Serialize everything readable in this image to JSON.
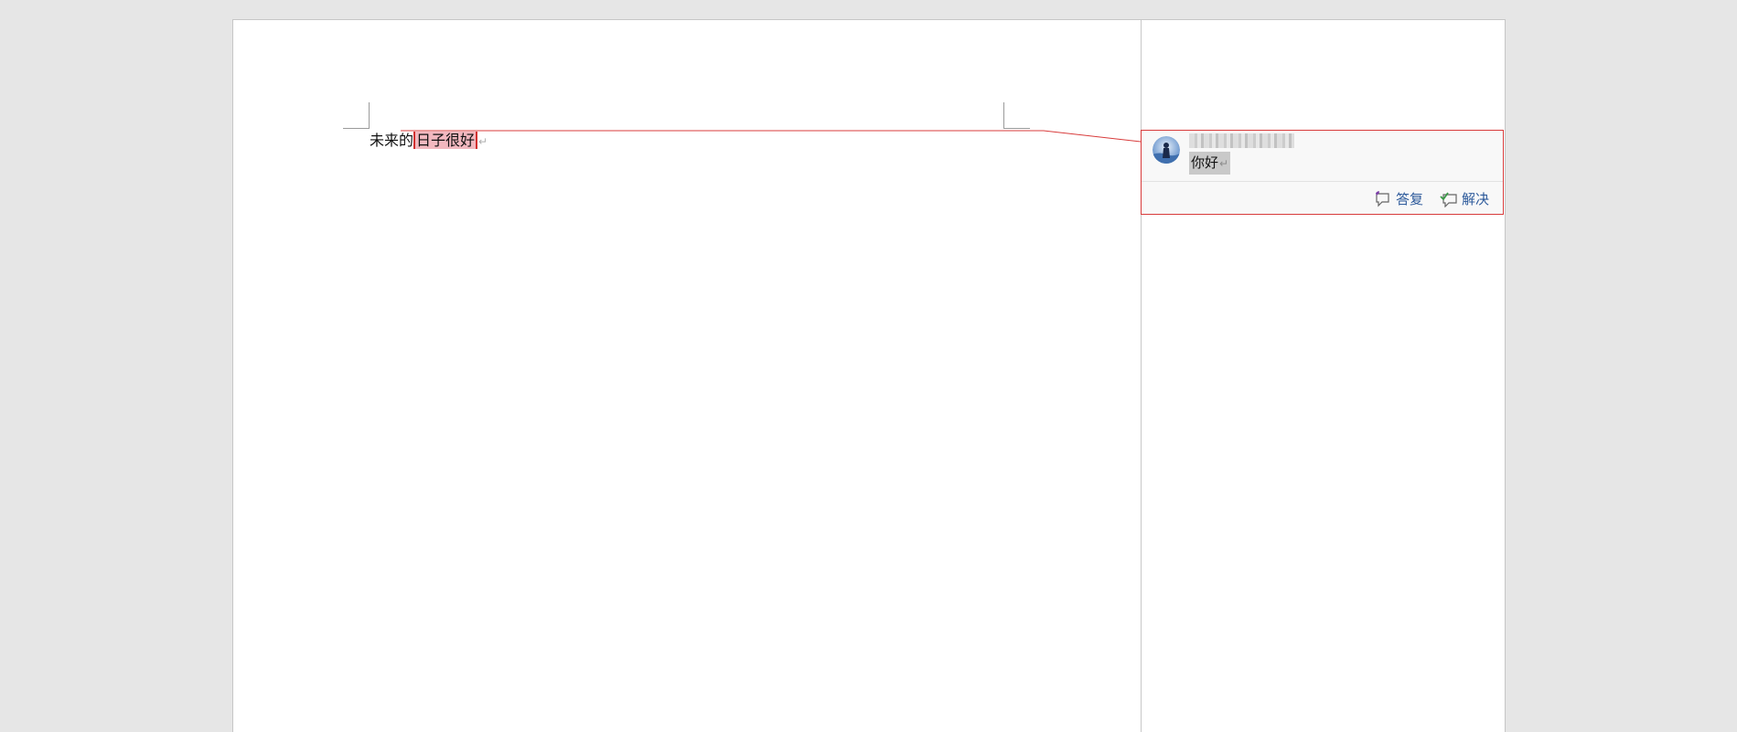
{
  "document": {
    "paragraph": {
      "lead_text": "未来的",
      "commented_text": "日子很好",
      "paragraph_mark": "↵"
    }
  },
  "comment": {
    "author": "",
    "text": "你好",
    "paragraph_mark": "↵",
    "avatar_icon": "user-avatar-icon",
    "actions": {
      "reply_label": "答复",
      "resolve_label": "解决"
    }
  },
  "colors": {
    "comment_accent": "#d83b3b",
    "comment_highlight": "#f2b8bf",
    "action_link": "#2d5a9b"
  }
}
